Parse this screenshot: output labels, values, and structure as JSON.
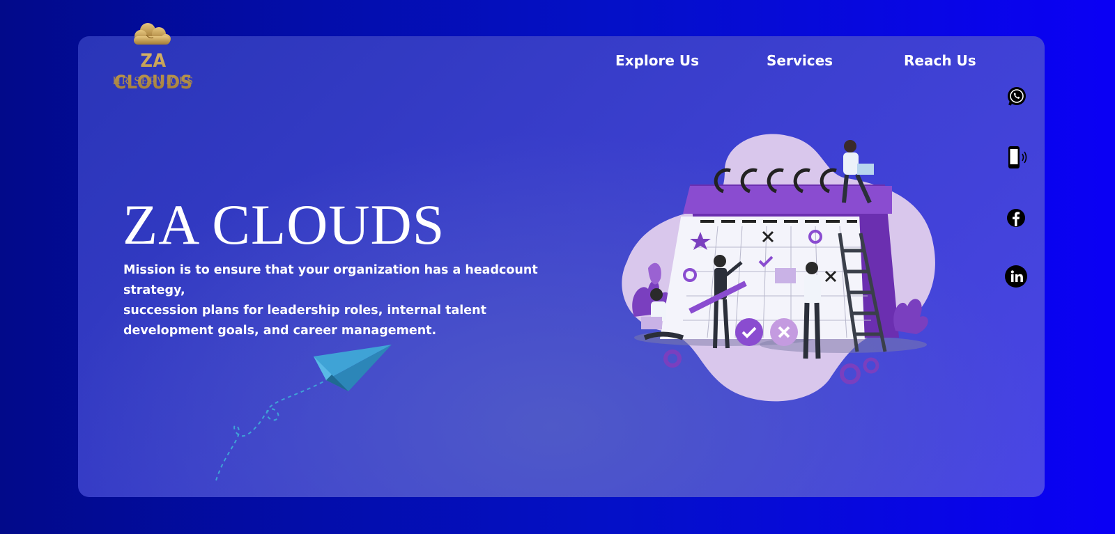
{
  "brand": {
    "logo_title": "ZA CLOUDS",
    "logo_subtitle": "HR SERVICES",
    "gold": "#c9a45a"
  },
  "nav": {
    "items": [
      {
        "label": "Explore Us"
      },
      {
        "label": "Services"
      },
      {
        "label": "Reach Us"
      }
    ]
  },
  "social": {
    "icons": [
      "whatsapp-icon",
      "phone-icon",
      "facebook-icon",
      "linkedin-icon"
    ]
  },
  "hero": {
    "title": "ZA CLOUDS",
    "description_line1": "Mission is to ensure that your organization has a headcount strategy,",
    "description_line2": "succession plans for leadership roles, internal talent development goals, and career management."
  },
  "colors": {
    "background_dark": "#020a8a",
    "background_bright": "#0a00f5",
    "card": "#3b3fce",
    "accent_purple": "#7b3fbf",
    "plane_blue": "#3fa3d6"
  }
}
